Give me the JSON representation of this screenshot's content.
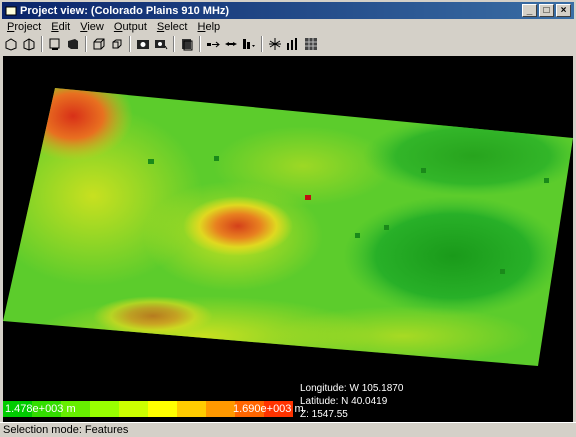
{
  "window": {
    "title": "Project view: (Colorado Plains 910 MHz)"
  },
  "menu": [
    "Project",
    "Edit",
    "View",
    "Output",
    "Select",
    "Help"
  ],
  "toolbar_icons": [
    "open-icon",
    "open-folder-icon",
    "cube-view-icon",
    "solid-view-icon",
    "cube-outline-icon",
    "cube-small-icon",
    "camera-icon",
    "camera-rotate-icon",
    "layers-icon",
    "arrow-right-icon",
    "arrow-double-icon",
    "chart-dropdown-icon",
    "antenna-icon",
    "signal-bars-icon",
    "grid-icon"
  ],
  "viewport": {
    "coords": {
      "longitude": "Longitude: W  105.1870",
      "latitude": "Latitude: N  40.0419",
      "z": "Z: 1547.55"
    },
    "legend": {
      "min_label": "1.478e+003  m",
      "max_label": "1.690e+003  m",
      "colors": [
        "#00cc00",
        "#33dd00",
        "#66ee00",
        "#99ff00",
        "#ccff00",
        "#ffff00",
        "#ffcc00",
        "#ff9900",
        "#ff6600",
        "#ff3300"
      ]
    }
  },
  "status": {
    "text": "Selection mode: Features"
  }
}
